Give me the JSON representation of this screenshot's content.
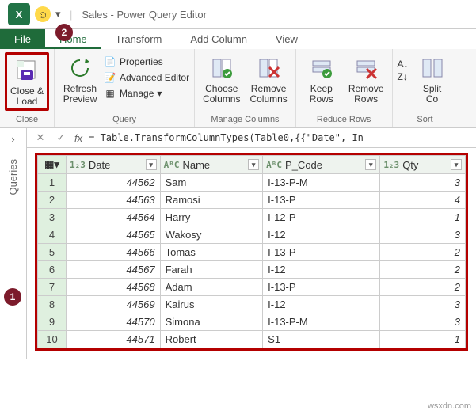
{
  "title": "Sales - Power Query Editor",
  "callouts": {
    "c1": "1",
    "c2": "2"
  },
  "tabs": {
    "file": "File",
    "home": "Home",
    "transform": "Transform",
    "addcol": "Add Column",
    "view": "View"
  },
  "ribbon": {
    "close": {
      "btn": "Close &\nLoad",
      "group": "Close"
    },
    "query": {
      "refresh": "Refresh\nPreview",
      "properties": "Properties",
      "advanced": "Advanced Editor",
      "manage": "Manage",
      "group": "Query"
    },
    "managecols": {
      "choose": "Choose\nColumns",
      "remove": "Remove\nColumns",
      "group": "Manage Columns"
    },
    "reducerows": {
      "keep": "Keep\nRows",
      "remove": "Remove\nRows",
      "group": "Reduce Rows"
    },
    "sort": {
      "split": "Split\nCo",
      "group": "Sort"
    }
  },
  "sidebar": {
    "label": "Queries"
  },
  "formula": "= Table.TransformColumnTypes(Table0,{{\"Date\", In",
  "chart_data": {
    "type": "table",
    "columns": [
      {
        "type": "1₂3",
        "name": "Date"
      },
      {
        "type": "AᴮC",
        "name": "Name"
      },
      {
        "type": "AᴮC",
        "name": "P_Code"
      },
      {
        "type": "1₂3",
        "name": "Qty"
      }
    ],
    "rows": [
      {
        "n": 1,
        "date": 44562,
        "name": "Sam",
        "pcode": "I-13-P-M",
        "qty": 3
      },
      {
        "n": 2,
        "date": 44563,
        "name": "Ramosi",
        "pcode": "I-13-P",
        "qty": 4
      },
      {
        "n": 3,
        "date": 44564,
        "name": "Harry",
        "pcode": "I-12-P",
        "qty": 1
      },
      {
        "n": 4,
        "date": 44565,
        "name": "Wakosy",
        "pcode": "I-12",
        "qty": 3
      },
      {
        "n": 5,
        "date": 44566,
        "name": "Tomas",
        "pcode": "I-13-P",
        "qty": 2
      },
      {
        "n": 6,
        "date": 44567,
        "name": "Farah",
        "pcode": "I-12",
        "qty": 2
      },
      {
        "n": 7,
        "date": 44568,
        "name": "Adam",
        "pcode": "I-13-P",
        "qty": 2
      },
      {
        "n": 8,
        "date": 44569,
        "name": "Kairus",
        "pcode": "I-12",
        "qty": 3
      },
      {
        "n": 9,
        "date": 44570,
        "name": "Simona",
        "pcode": "I-13-P-M",
        "qty": 3
      },
      {
        "n": 10,
        "date": 44571,
        "name": "Robert",
        "pcode": "S1",
        "qty": 1
      }
    ]
  },
  "watermark": "wsxdn.com"
}
